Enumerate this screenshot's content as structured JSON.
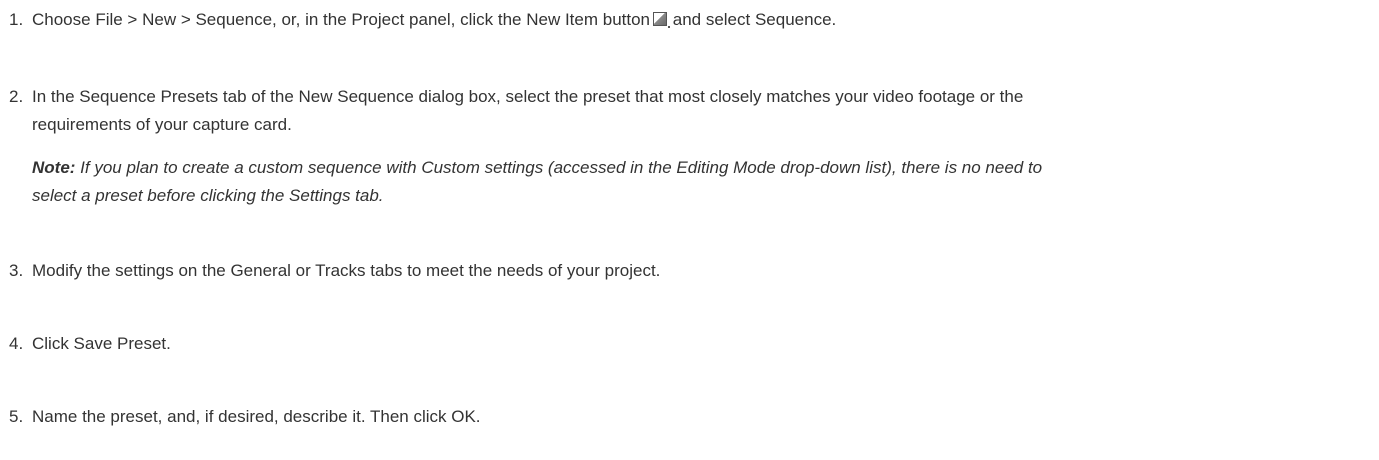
{
  "steps": [
    {
      "number": "1.",
      "text_before_icon": "Choose File > New > Sequence, or, in the Project panel, click the New Item button",
      "icon": "new-item-icon",
      "text_after_icon": " and select Sequence."
    },
    {
      "number": "2.",
      "text_line1": "In the Sequence Presets tab of the New Sequence dialog box, select the preset that most closely matches your video footage or the",
      "text_line2": "requirements of your capture card.",
      "note_label": "Note:",
      "note_line1": " If you plan to create a custom sequence with Custom settings (accessed in the Editing Mode drop-down list), there is no need to",
      "note_line2": "select a preset before clicking the Settings tab."
    },
    {
      "number": "3.",
      "text": "Modify the settings on the General or Tracks tabs to meet the needs of your project."
    },
    {
      "number": "4.",
      "text": "Click Save Preset."
    },
    {
      "number": "5.",
      "text": "Name the preset, and, if desired, describe it. Then click OK."
    }
  ]
}
